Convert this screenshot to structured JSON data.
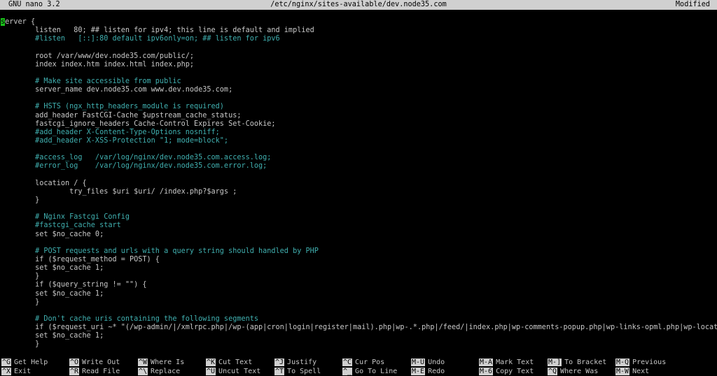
{
  "titlebar": {
    "version": "GNU nano 3.2",
    "filename": "/etc/nginx/sites-available/dev.node35.com",
    "status": "Modified"
  },
  "editor": {
    "cursor_char": "s",
    "lines": [
      {
        "text": "erver {",
        "kind": "code",
        "cursor": true
      },
      {
        "text": "        listen   80; ## listen for ipv4; this line is default and implied",
        "kind": "code"
      },
      {
        "text": "        #listen   [::]:80 default ipv6only=on; ## listen for ipv6",
        "kind": "comment"
      },
      {
        "text": "",
        "kind": "code"
      },
      {
        "text": "        root /var/www/dev.node35.com/public/;",
        "kind": "code"
      },
      {
        "text": "        index index.htm index.html index.php;",
        "kind": "code"
      },
      {
        "text": "",
        "kind": "code"
      },
      {
        "text": "        # Make site accessible from public",
        "kind": "comment"
      },
      {
        "text": "        server_name dev.node35.com www.dev.node35.com;",
        "kind": "code"
      },
      {
        "text": "",
        "kind": "code"
      },
      {
        "text": "        # HSTS (ngx_http_headers_module is required)",
        "kind": "comment"
      },
      {
        "text": "        add_header FastCGI-Cache $upstream_cache_status;",
        "kind": "code"
      },
      {
        "text": "        fastcgi_ignore_headers Cache-Control Expires Set-Cookie;",
        "kind": "code"
      },
      {
        "text": "        #add_header X-Content-Type-Options nosniff;",
        "kind": "comment"
      },
      {
        "text": "        #add_header X-XSS-Protection \"1; mode=block\";",
        "kind": "comment"
      },
      {
        "text": "",
        "kind": "code"
      },
      {
        "text": "        #access_log   /var/log/nginx/dev.node35.com.access.log;",
        "kind": "comment"
      },
      {
        "text": "        #error_log    /var/log/nginx/dev.node35.com.error.log;",
        "kind": "comment"
      },
      {
        "text": "",
        "kind": "code"
      },
      {
        "text": "        location / {",
        "kind": "code"
      },
      {
        "text": "                try_files $uri $uri/ /index.php?$args ;",
        "kind": "code"
      },
      {
        "text": "        }",
        "kind": "code"
      },
      {
        "text": "",
        "kind": "code"
      },
      {
        "text": "        # Nginx Fastcgi Config",
        "kind": "comment"
      },
      {
        "text": "        #fastcgi_cache start",
        "kind": "comment"
      },
      {
        "text": "        set $no_cache 0;",
        "kind": "code"
      },
      {
        "text": "",
        "kind": "code"
      },
      {
        "text": "        # POST requests and urls with a query string should handled by PHP",
        "kind": "comment"
      },
      {
        "text": "        if ($request_method = POST) {",
        "kind": "code"
      },
      {
        "text": "        set $no_cache 1;",
        "kind": "code"
      },
      {
        "text": "        }",
        "kind": "code"
      },
      {
        "text": "        if ($query_string != \"\") {",
        "kind": "code"
      },
      {
        "text": "        set $no_cache 1;",
        "kind": "code"
      },
      {
        "text": "        }",
        "kind": "code"
      },
      {
        "text": "",
        "kind": "code"
      },
      {
        "text": "        # Don't cache uris containing the following segments",
        "kind": "comment"
      },
      {
        "text": "        if ($request_uri ~* \"(/wp-admin/|/xmlrpc.php|/wp-(app|cron|login|register|mail).php|wp-.*.php|/feed/|index.php|wp-comments-popup.php|wp-links-opml.php|wp-locat$",
        "kind": "code"
      },
      {
        "text": "        set $no_cache 1;",
        "kind": "code"
      },
      {
        "text": "        }",
        "kind": "code"
      }
    ]
  },
  "shortcuts": {
    "row1": [
      {
        "key": "^G",
        "label": "Get Help"
      },
      {
        "key": "^O",
        "label": "Write Out"
      },
      {
        "key": "^W",
        "label": "Where Is"
      },
      {
        "key": "^K",
        "label": "Cut Text"
      },
      {
        "key": "^J",
        "label": "Justify"
      },
      {
        "key": "^C",
        "label": "Cur Pos"
      },
      {
        "key": "M-U",
        "label": "Undo"
      },
      {
        "key": "M-A",
        "label": "Mark Text"
      },
      {
        "key": "M-]",
        "label": "To Bracket"
      },
      {
        "key": "M-Q",
        "label": "Previous"
      }
    ],
    "row2": [
      {
        "key": "^X",
        "label": "Exit"
      },
      {
        "key": "^R",
        "label": "Read File"
      },
      {
        "key": "^\\",
        "label": "Replace"
      },
      {
        "key": "^U",
        "label": "Uncut Text"
      },
      {
        "key": "^T",
        "label": "To Spell"
      },
      {
        "key": "^_",
        "label": "Go To Line"
      },
      {
        "key": "M-E",
        "label": "Redo"
      },
      {
        "key": "M-6",
        "label": "Copy Text"
      },
      {
        "key": "^Q",
        "label": "Where Was"
      },
      {
        "key": "M-W",
        "label": "Next"
      }
    ]
  }
}
